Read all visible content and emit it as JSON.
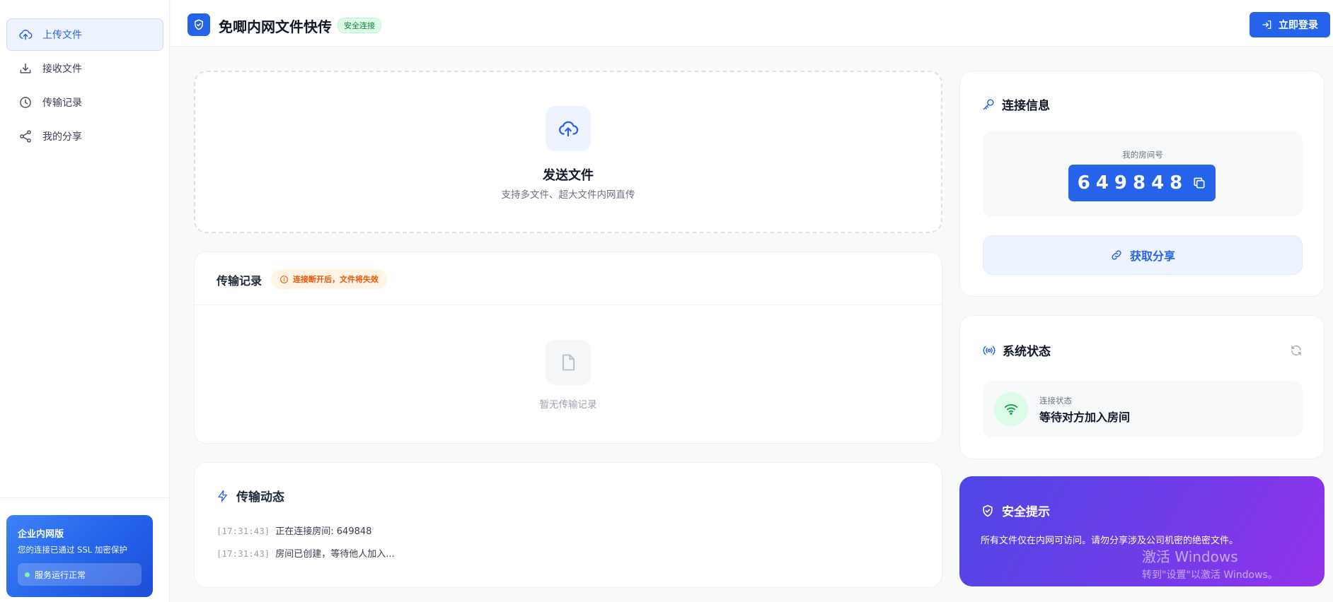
{
  "sidebar": {
    "items": [
      {
        "label": "上传文件",
        "icon": "upload-cloud-icon",
        "active": true
      },
      {
        "label": "接收文件",
        "icon": "download-icon",
        "active": false
      },
      {
        "label": "传输记录",
        "icon": "clock-icon",
        "active": false
      },
      {
        "label": "我的分享",
        "icon": "share-icon",
        "active": false
      }
    ],
    "enterprise": {
      "title": "企业内网版",
      "subtitle": "您的连接已通过 SSL 加密保护",
      "status": "服务运行正常"
    }
  },
  "header": {
    "title": "免唧内网文件快传",
    "badge": "安全连接",
    "login_label": "立即登录"
  },
  "upload": {
    "title": "发送文件",
    "subtitle": "支持多文件、超大文件内网直传"
  },
  "records": {
    "title": "传输记录",
    "warning": "连接断开后，文件将失效",
    "empty": "暂无传输记录"
  },
  "activity": {
    "title": "传输动态",
    "logs": [
      {
        "time": "[17:31:43]",
        "text": "正在连接房间: 649848"
      },
      {
        "time": "[17:31:43]",
        "text": "房间已创建，等待他人加入..."
      }
    ]
  },
  "connection": {
    "title": "连接信息",
    "room_label": "我的房间号",
    "room_code": "649848",
    "share_label": "获取分享"
  },
  "system": {
    "title": "系统状态",
    "status_label": "连接状态",
    "status_value": "等待对方加入房间"
  },
  "security": {
    "title": "安全提示",
    "text": "所有文件仅在内网可访问。请勿分享涉及公司机密的绝密文件。"
  },
  "watermark": {
    "line1": "激活 Windows",
    "line2": "转到\"设置\"以激活 Windows。"
  },
  "colors": {
    "primary": "#2563eb",
    "success": "#16a34a",
    "warning": "#ea580c",
    "security_gradient_start": "#4f46e5",
    "security_gradient_end": "#9333ea"
  }
}
